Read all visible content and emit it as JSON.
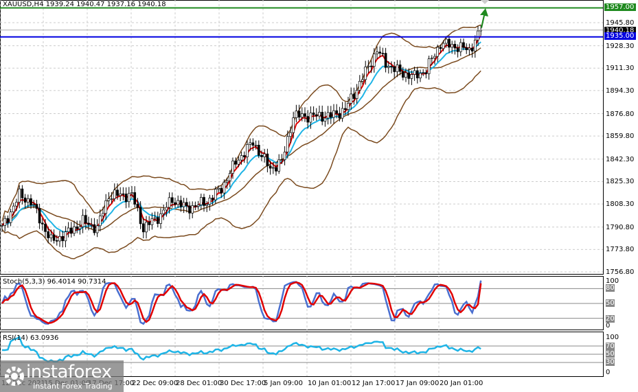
{
  "header": {
    "symbol_line": "XAUUSD,H4  1939.24 1940.47 1937.16 1940.18"
  },
  "price_axis": [
    "1945.80",
    "1928.30",
    "1911.30",
    "1894.30",
    "1876.80",
    "1859.80",
    "1842.30",
    "1825.30",
    "1808.30",
    "1790.80",
    "1773.80",
    "1756.80"
  ],
  "tags": {
    "green_level": "1957.00",
    "current": "1940.18",
    "blue_level": "1935.00"
  },
  "stoch": {
    "title": "Stoch(5,3,3) 96.4014 90.7314",
    "levels": [
      "100",
      "80",
      "50",
      "20",
      "0"
    ]
  },
  "rsi": {
    "title": "RSI(14) 63.0936",
    "levels": [
      "100",
      "70",
      "50",
      "30",
      "0"
    ]
  },
  "time_axis": [
    "12 Dec 2021",
    "15 Dec 01:00",
    "17 Dec 17:00",
    "22 Dec 09:00",
    "28 Dec 01:00",
    "30 Dec 17:00",
    "5 Jan 09:00",
    "10 Jan 01:00",
    "12 Jan 17:00",
    "17 Jan 09:00",
    "20 Jan 01:00"
  ],
  "logo": {
    "name": "instaforex",
    "tagline": "Instant Forex Trading"
  },
  "colors": {
    "green": "#1f8a1f",
    "blue": "#0000e0",
    "red": "#e00000",
    "cyan": "#1eb4e6",
    "brown": "#7a4a1e",
    "stoch_main": "#4a6fd0"
  },
  "chart_data": {
    "type": "candlestick",
    "symbol": "XAUUSD",
    "timeframe": "H4",
    "ylim": [
      1756.8,
      1957
    ],
    "close_keypoints": [
      [
        0,
        1790
      ],
      [
        6,
        1815
      ],
      [
        10,
        1810
      ],
      [
        17,
        1780
      ],
      [
        22,
        1785
      ],
      [
        28,
        1795
      ],
      [
        33,
        1790
      ],
      [
        37,
        1815
      ],
      [
        45,
        1815
      ],
      [
        49,
        1790
      ],
      [
        55,
        1800
      ],
      [
        59,
        1812
      ],
      [
        64,
        1805
      ],
      [
        71,
        1810
      ],
      [
        76,
        1820
      ],
      [
        81,
        1840
      ],
      [
        87,
        1855
      ],
      [
        93,
        1835
      ],
      [
        97,
        1840
      ],
      [
        101,
        1875
      ],
      [
        106,
        1875
      ],
      [
        114,
        1875
      ],
      [
        119,
        1880
      ],
      [
        124,
        1900
      ],
      [
        130,
        1925
      ],
      [
        133,
        1915
      ],
      [
        138,
        1908
      ],
      [
        143,
        1905
      ],
      [
        147,
        1910
      ],
      [
        152,
        1930
      ],
      [
        157,
        1928
      ],
      [
        162,
        1925
      ],
      [
        166,
        1940
      ]
    ],
    "horizontal_levels": [
      1957.0,
      1935.0
    ],
    "last_close": 1940.18
  }
}
